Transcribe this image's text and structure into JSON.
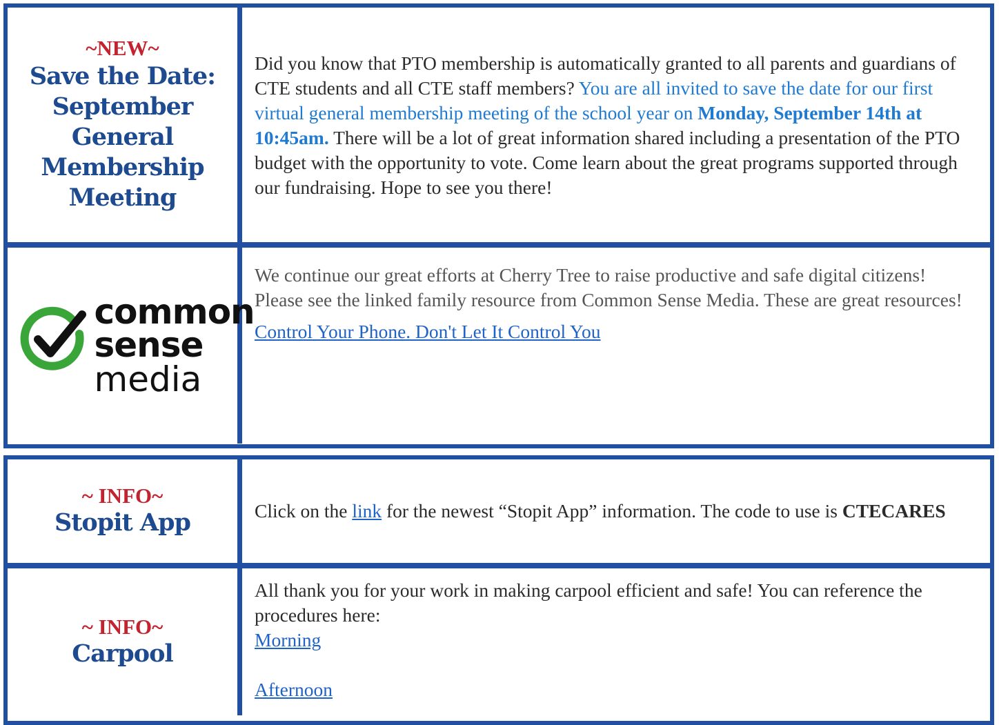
{
  "meeting": {
    "tag": "~NEW~",
    "title": "Save the Date: September General Membership Meeting",
    "text_1": "Did you know that PTO membership is automatically granted to all parents and guardians of CTE students and all CTE staff members? ",
    "text_blue": "You are all invited to save the date for our first virtual general membership meeting of the school year on ",
    "text_bold": "Monday, September 14th at 10:45am.",
    "text_2": " There will be a lot of great information shared including a presentation of the PTO budget with the opportunity to vote. Come learn about the great programs supported through our fundraising. Hope to see you there!"
  },
  "common_sense": {
    "logo_word_1": "common",
    "logo_word_2": "sense",
    "logo_word_3": "media",
    "text": "We continue our great efforts at Cherry Tree to raise productive and safe digital citizens! Please see the linked family resource from Common Sense Media.  These are  great resources!",
    "link": "Control Your Phone. Don't Let It Control You"
  },
  "stopit": {
    "tag": "~ INFO~",
    "title": "Stopit App",
    "text_1": "Click on the ",
    "link": "link",
    "text_2": " for the newest “Stopit App” information.  The code to use is ",
    "code": "CTECARES"
  },
  "carpool": {
    "tag": "~ INFO~",
    "title": "Carpool",
    "text": "All thank you for your work in making carpool efficient and safe!  You can reference the procedures here:",
    "link_morning": "Morning",
    "link_afternoon": "Afternoon"
  },
  "colors": {
    "border": "#2150a2",
    "heading": "#1e4a8f",
    "tag": "#c2232f",
    "highlight": "#1f7ad1",
    "link": "#1f63c7",
    "logo_green": "#3aa538"
  }
}
